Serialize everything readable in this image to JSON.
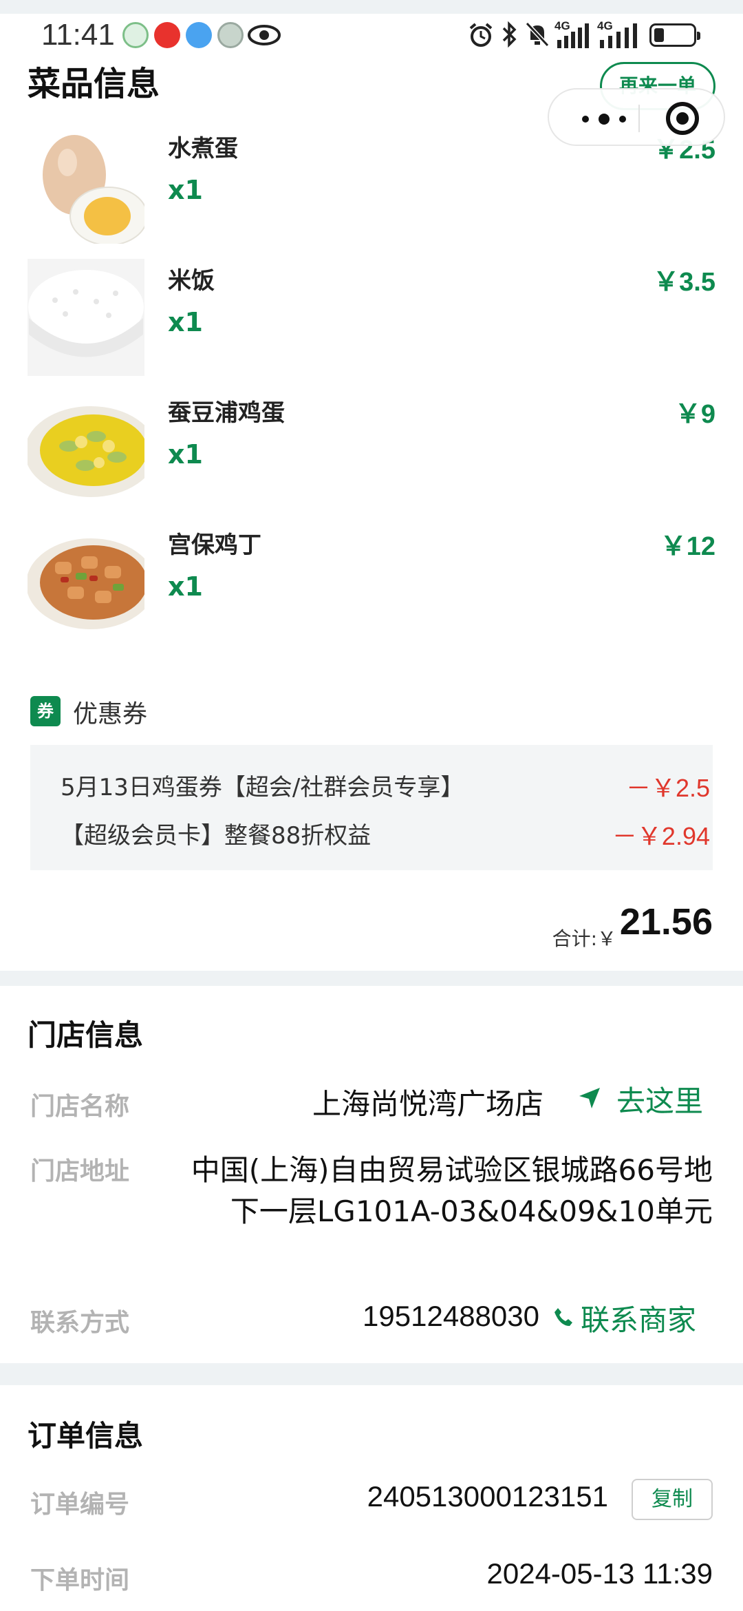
{
  "status_bar": {
    "time": "11:41",
    "signal_1": "4G",
    "signal_2": "4G"
  },
  "dishes_section": {
    "title": "菜品信息",
    "reorder_label": "再来一单",
    "items": [
      {
        "name": "水煮蛋",
        "qty": "x1",
        "price": "￥2.5"
      },
      {
        "name": "米饭",
        "qty": "x1",
        "price": "￥3.5"
      },
      {
        "name": "蚕豆浦鸡蛋",
        "qty": "x1",
        "price": "￥9"
      },
      {
        "name": "宫保鸡丁",
        "qty": "x1",
        "price": "￥12"
      }
    ],
    "coupon_icon_text": "券",
    "coupon_label": "优惠券",
    "coupons": [
      {
        "name": "5月13日鸡蛋券【超会/社群会员专享】",
        "amount": "－￥2.5"
      },
      {
        "name": "【超级会员卡】整餐88折权益",
        "amount": "－￥2.94"
      }
    ],
    "total_label": "合计:￥",
    "total_value": "21.56"
  },
  "store_section": {
    "title": "门店信息",
    "name_label": "门店名称",
    "name_value": "上海尚悦湾广场店",
    "nav_label": "去这里",
    "address_label": "门店地址",
    "address_value": "中国(上海)自由贸易试验区银城路66号地下一层LG101A-03&04&09&10单元",
    "contact_label": "联系方式",
    "phone_value": "19512488030",
    "contact_action": "联系商家"
  },
  "order_section": {
    "title": "订单信息",
    "order_no_label": "订单编号",
    "order_no_value": "240513000123151",
    "copy_label": "复制",
    "time_label": "下单时间",
    "time_value": "2024-05-13 11:39"
  },
  "colors": {
    "brand_green": "#0e8a4f",
    "discount_red": "#e0372c"
  },
  "icons": [
    "app-notification-icons",
    "alarm-icon",
    "bluetooth-icon",
    "mute-icon",
    "battery-icon",
    "more-dots-icon",
    "target-icon",
    "coupon-icon",
    "navigate-arrow-icon",
    "phone-icon"
  ]
}
